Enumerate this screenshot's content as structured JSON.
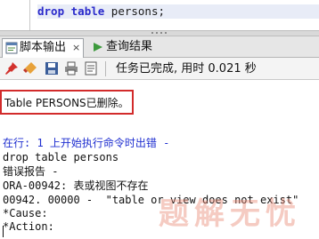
{
  "editor": {
    "keyword1": "drop",
    "keyword2": "table",
    "identifier": " persons;"
  },
  "tabs": [
    {
      "label": "脚本输出",
      "icon": "script-output-icon",
      "close": "×"
    },
    {
      "label": "查询结果",
      "icon": "query-result-icon"
    }
  ],
  "toolbar": {
    "status": "任务已完成, 用时 0.021 秒",
    "icons": [
      "pin-icon",
      "eraser-icon",
      "save-icon",
      "print-icon",
      "open-file-icon"
    ]
  },
  "output": {
    "result": "Table PERSONS已删除。",
    "lines": [
      "在行: 1 上开始执行命令时出错 -",
      "drop table persons",
      "错误报告 -",
      "ORA-00942: 表或视图不存在",
      "00942. 00000 -  \"table or view does not exist\"",
      "*Cause:",
      "*Action:"
    ]
  },
  "watermark": "题解无忧",
  "colors": {
    "keyword": "#2a2acb",
    "error_line": "#1f2fd0",
    "highlight_border": "#d22b2b"
  }
}
